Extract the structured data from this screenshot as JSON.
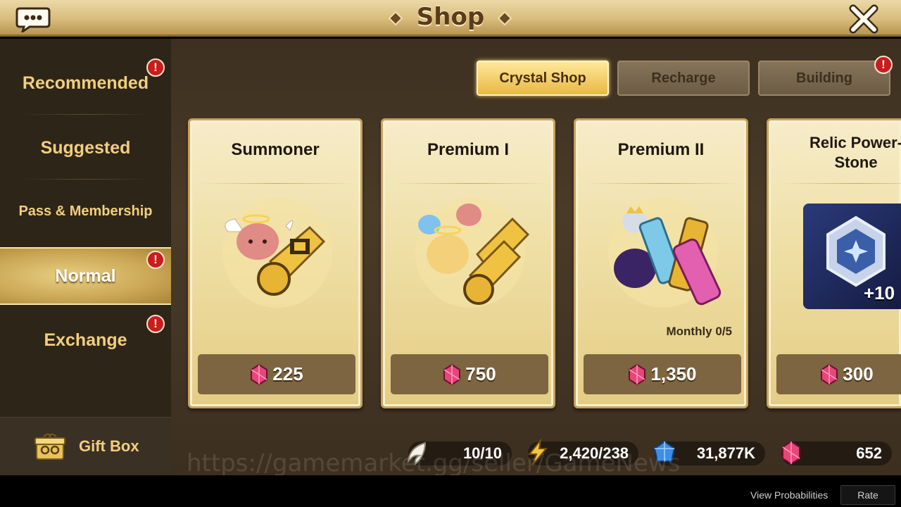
{
  "header": {
    "title": "Shop"
  },
  "sidebar": {
    "items": [
      {
        "label": "Recommended",
        "alert": "!"
      },
      {
        "label": "Suggested"
      },
      {
        "label": "Pass & Membership"
      },
      {
        "label": "Normal",
        "alert": "!",
        "active": true
      },
      {
        "label": "Exchange",
        "alert": "!"
      }
    ],
    "gift_box": {
      "label": "Gift Box"
    }
  },
  "tabs": [
    {
      "label": "Crystal Shop",
      "active": true
    },
    {
      "label": "Recharge"
    },
    {
      "label": "Building",
      "alert": "!"
    }
  ],
  "cards": [
    {
      "name": "Summoner",
      "price": "225",
      "icon": "crystal-gem-icon"
    },
    {
      "name": "Premium I",
      "price": "750",
      "icon": "crystal-gem-icon"
    },
    {
      "name": "Premium II",
      "price": "1,350",
      "limit": "Monthly 0/5",
      "icon": "crystal-gem-icon"
    },
    {
      "name_line1": "Relic Power-",
      "name_line2": "Stone",
      "price": "300",
      "badge": "+10",
      "icon": "crystal-gem-icon"
    }
  ],
  "resources": {
    "wings": "10/10",
    "energy": "2,420/238",
    "gold": "31,877K",
    "crystals": "652"
  },
  "watermark": "https://gamemarket.gg/seller/GameNews",
  "footer": {
    "view_probabilities": "View Probabilities",
    "rate": "Rate"
  },
  "colors": {
    "accent_gold": "#f2cf7d",
    "alert_red": "#c81d1d",
    "crystal_pink": "#e8457a"
  }
}
